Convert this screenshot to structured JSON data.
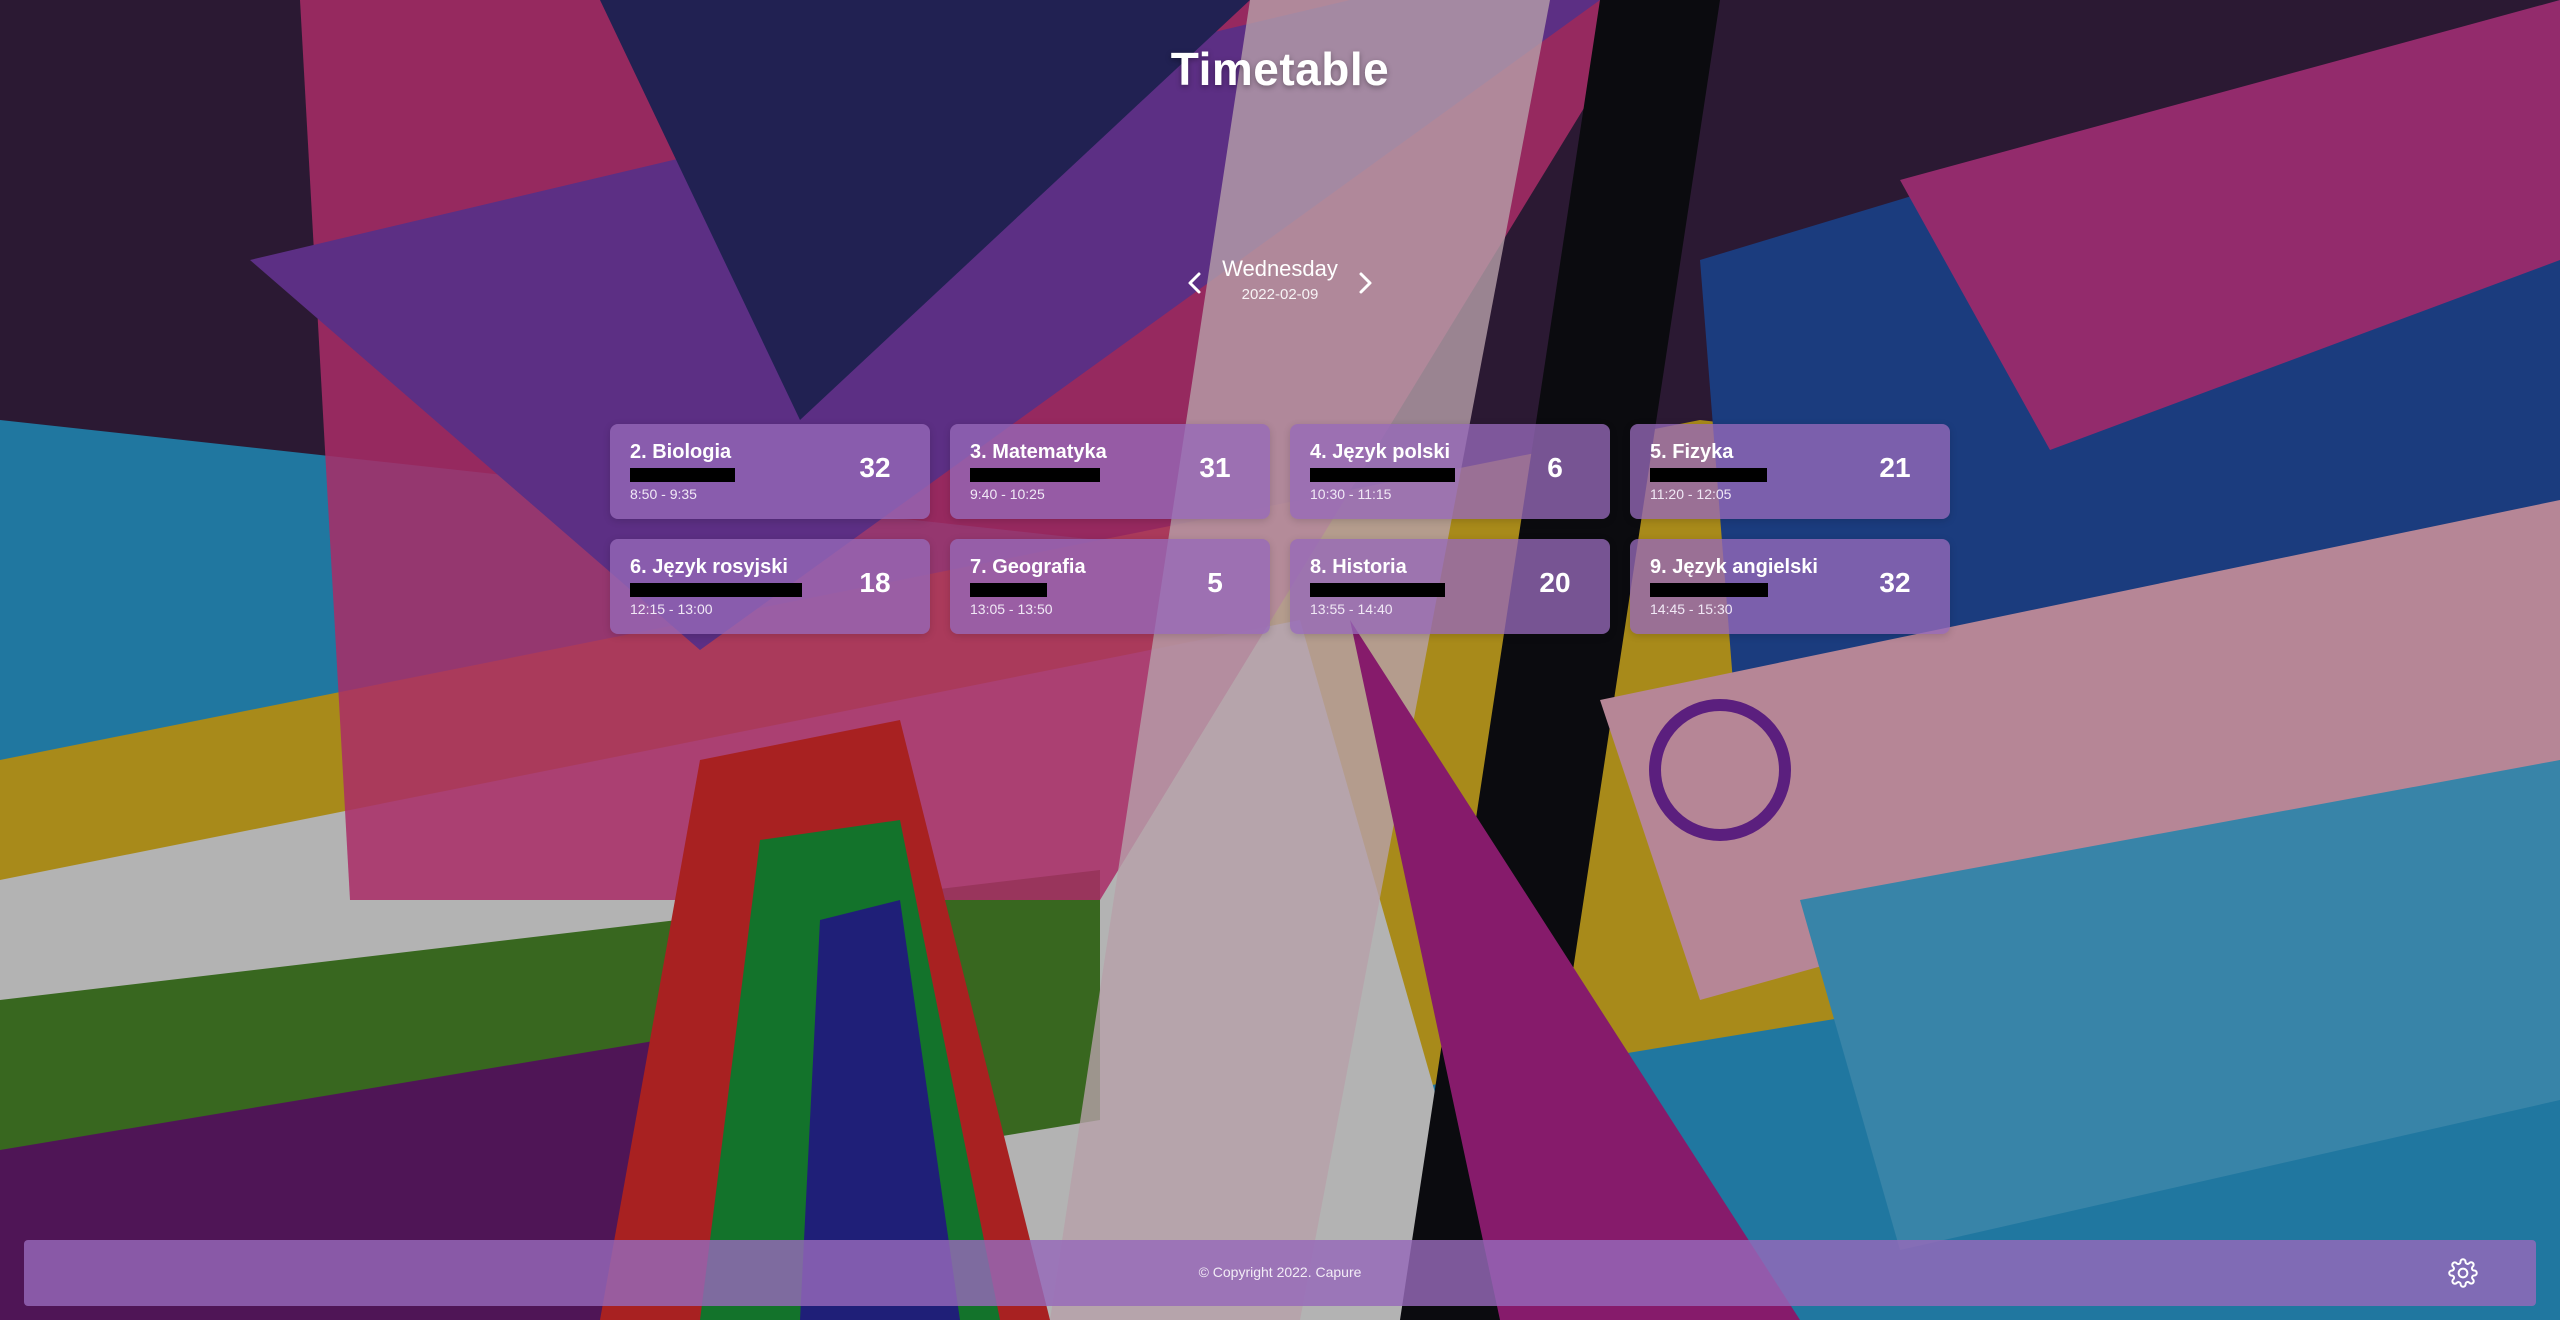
{
  "app": {
    "title": "Timetable"
  },
  "day_nav": {
    "day": "Wednesday",
    "date": "2022-02-09"
  },
  "lessons": [
    {
      "subject": "2. Biologia",
      "time": "8:50 - 9:35",
      "room": "32",
      "redact": 105
    },
    {
      "subject": "3. Matematyka",
      "time": "9:40 - 10:25",
      "room": "31",
      "redact": 130
    },
    {
      "subject": "4. Język polski",
      "time": "10:30 - 11:15",
      "room": "6",
      "redact": 145
    },
    {
      "subject": "5. Fizyka",
      "time": "11:20 - 12:05",
      "room": "21",
      "redact": 117
    },
    {
      "subject": "6. Język rosyjski",
      "time": "12:15 - 13:00",
      "room": "18",
      "redact": 172
    },
    {
      "subject": "7. Geografia",
      "time": "13:05 - 13:50",
      "room": "5",
      "redact": 77
    },
    {
      "subject": "8. Historia",
      "time": "13:55 - 14:40",
      "room": "20",
      "redact": 135
    },
    {
      "subject": "9. Język angielski",
      "time": "14:45 - 15:30",
      "room": "32",
      "redact": 118
    }
  ],
  "footer": {
    "copyright": "© Copyright 2022. Capure"
  },
  "icons": {
    "prev": "chevron-left-icon",
    "next": "chevron-right-icon",
    "settings": "gear-icon"
  },
  "colors": {
    "card": "#9669b9",
    "footer": "#9669b9",
    "text": "#ffffff"
  }
}
